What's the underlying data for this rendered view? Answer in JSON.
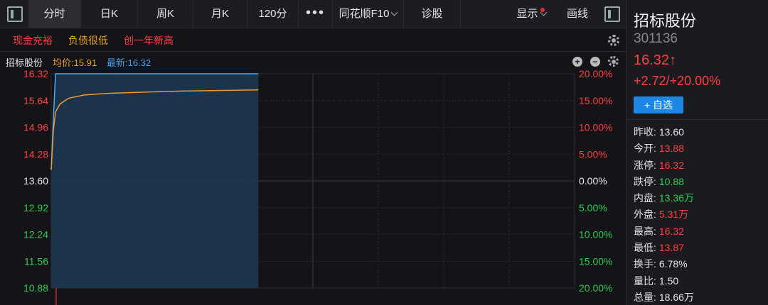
{
  "toolbar": {
    "tabs": [
      {
        "label": "分时",
        "active": true
      },
      {
        "label": "日K"
      },
      {
        "label": "周K"
      },
      {
        "label": "月K"
      },
      {
        "label": "120分"
      }
    ],
    "more": "•••",
    "f10": "同花顺F10",
    "diagnose": "诊股",
    "display": "显示",
    "draw": "画线"
  },
  "tags": [
    "现金充裕",
    "负债很低",
    "创一年新高"
  ],
  "chart_header": {
    "name": "招标股份",
    "avg_label": "均价:15.91",
    "latest_label": "最新:16.32"
  },
  "chart_data": {
    "type": "line",
    "left_ticks": [
      "16.32",
      "15.64",
      "14.96",
      "14.28",
      "13.60",
      "12.92",
      "12.24",
      "11.56",
      "10.88"
    ],
    "right_ticks": [
      "20.00%",
      "15.00%",
      "10.00%",
      "5.00%",
      "0.00%",
      "5.00%",
      "10.00%",
      "15.00%",
      "20.00%"
    ],
    "ylim": [
      10.88,
      16.32
    ],
    "prev_close": 13.6,
    "session_minutes": 240,
    "series": [
      {
        "values": [
          [
            0,
            13.88
          ],
          [
            1,
            15.2
          ],
          [
            2,
            16.32
          ],
          [
            95,
            16.32
          ]
        ]
      },
      {
        "values": [
          [
            0,
            13.88
          ],
          [
            1,
            14.9
          ],
          [
            2,
            15.35
          ],
          [
            4,
            15.55
          ],
          [
            8,
            15.7
          ],
          [
            15,
            15.78
          ],
          [
            25,
            15.82
          ],
          [
            40,
            15.85
          ],
          [
            60,
            15.88
          ],
          [
            95,
            15.91
          ]
        ]
      }
    ],
    "colors": {
      "price": "#4aa8ff",
      "avg": "#e89a3c",
      "fill": "#1c3a52",
      "grid": "#262a30"
    }
  },
  "panel": {
    "name": "招标股份",
    "code": "301136",
    "price": "16.32↑",
    "change": "+2.72/+20.00%",
    "add_button": "+ 自选",
    "stats": [
      {
        "k": "昨收:",
        "v": "13.60",
        "c": "white"
      },
      {
        "k": "今开:",
        "v": "13.88",
        "c": "red"
      },
      {
        "k": "涨停:",
        "v": "16.32",
        "c": "red"
      },
      {
        "k": "跌停:",
        "v": "10.88",
        "c": "green"
      },
      {
        "k": "内盘:",
        "v": "13.36万",
        "c": "green"
      },
      {
        "k": "外盘:",
        "v": "5.31万",
        "c": "red"
      },
      {
        "k": "最高:",
        "v": "16.32",
        "c": "red"
      },
      {
        "k": "最低:",
        "v": "13.87",
        "c": "red"
      },
      {
        "k": "换手:",
        "v": "6.78%",
        "c": "white"
      },
      {
        "k": "量比:",
        "v": "1.50",
        "c": "white"
      },
      {
        "k": "总量:",
        "v": "18.66万",
        "c": "white"
      }
    ]
  }
}
